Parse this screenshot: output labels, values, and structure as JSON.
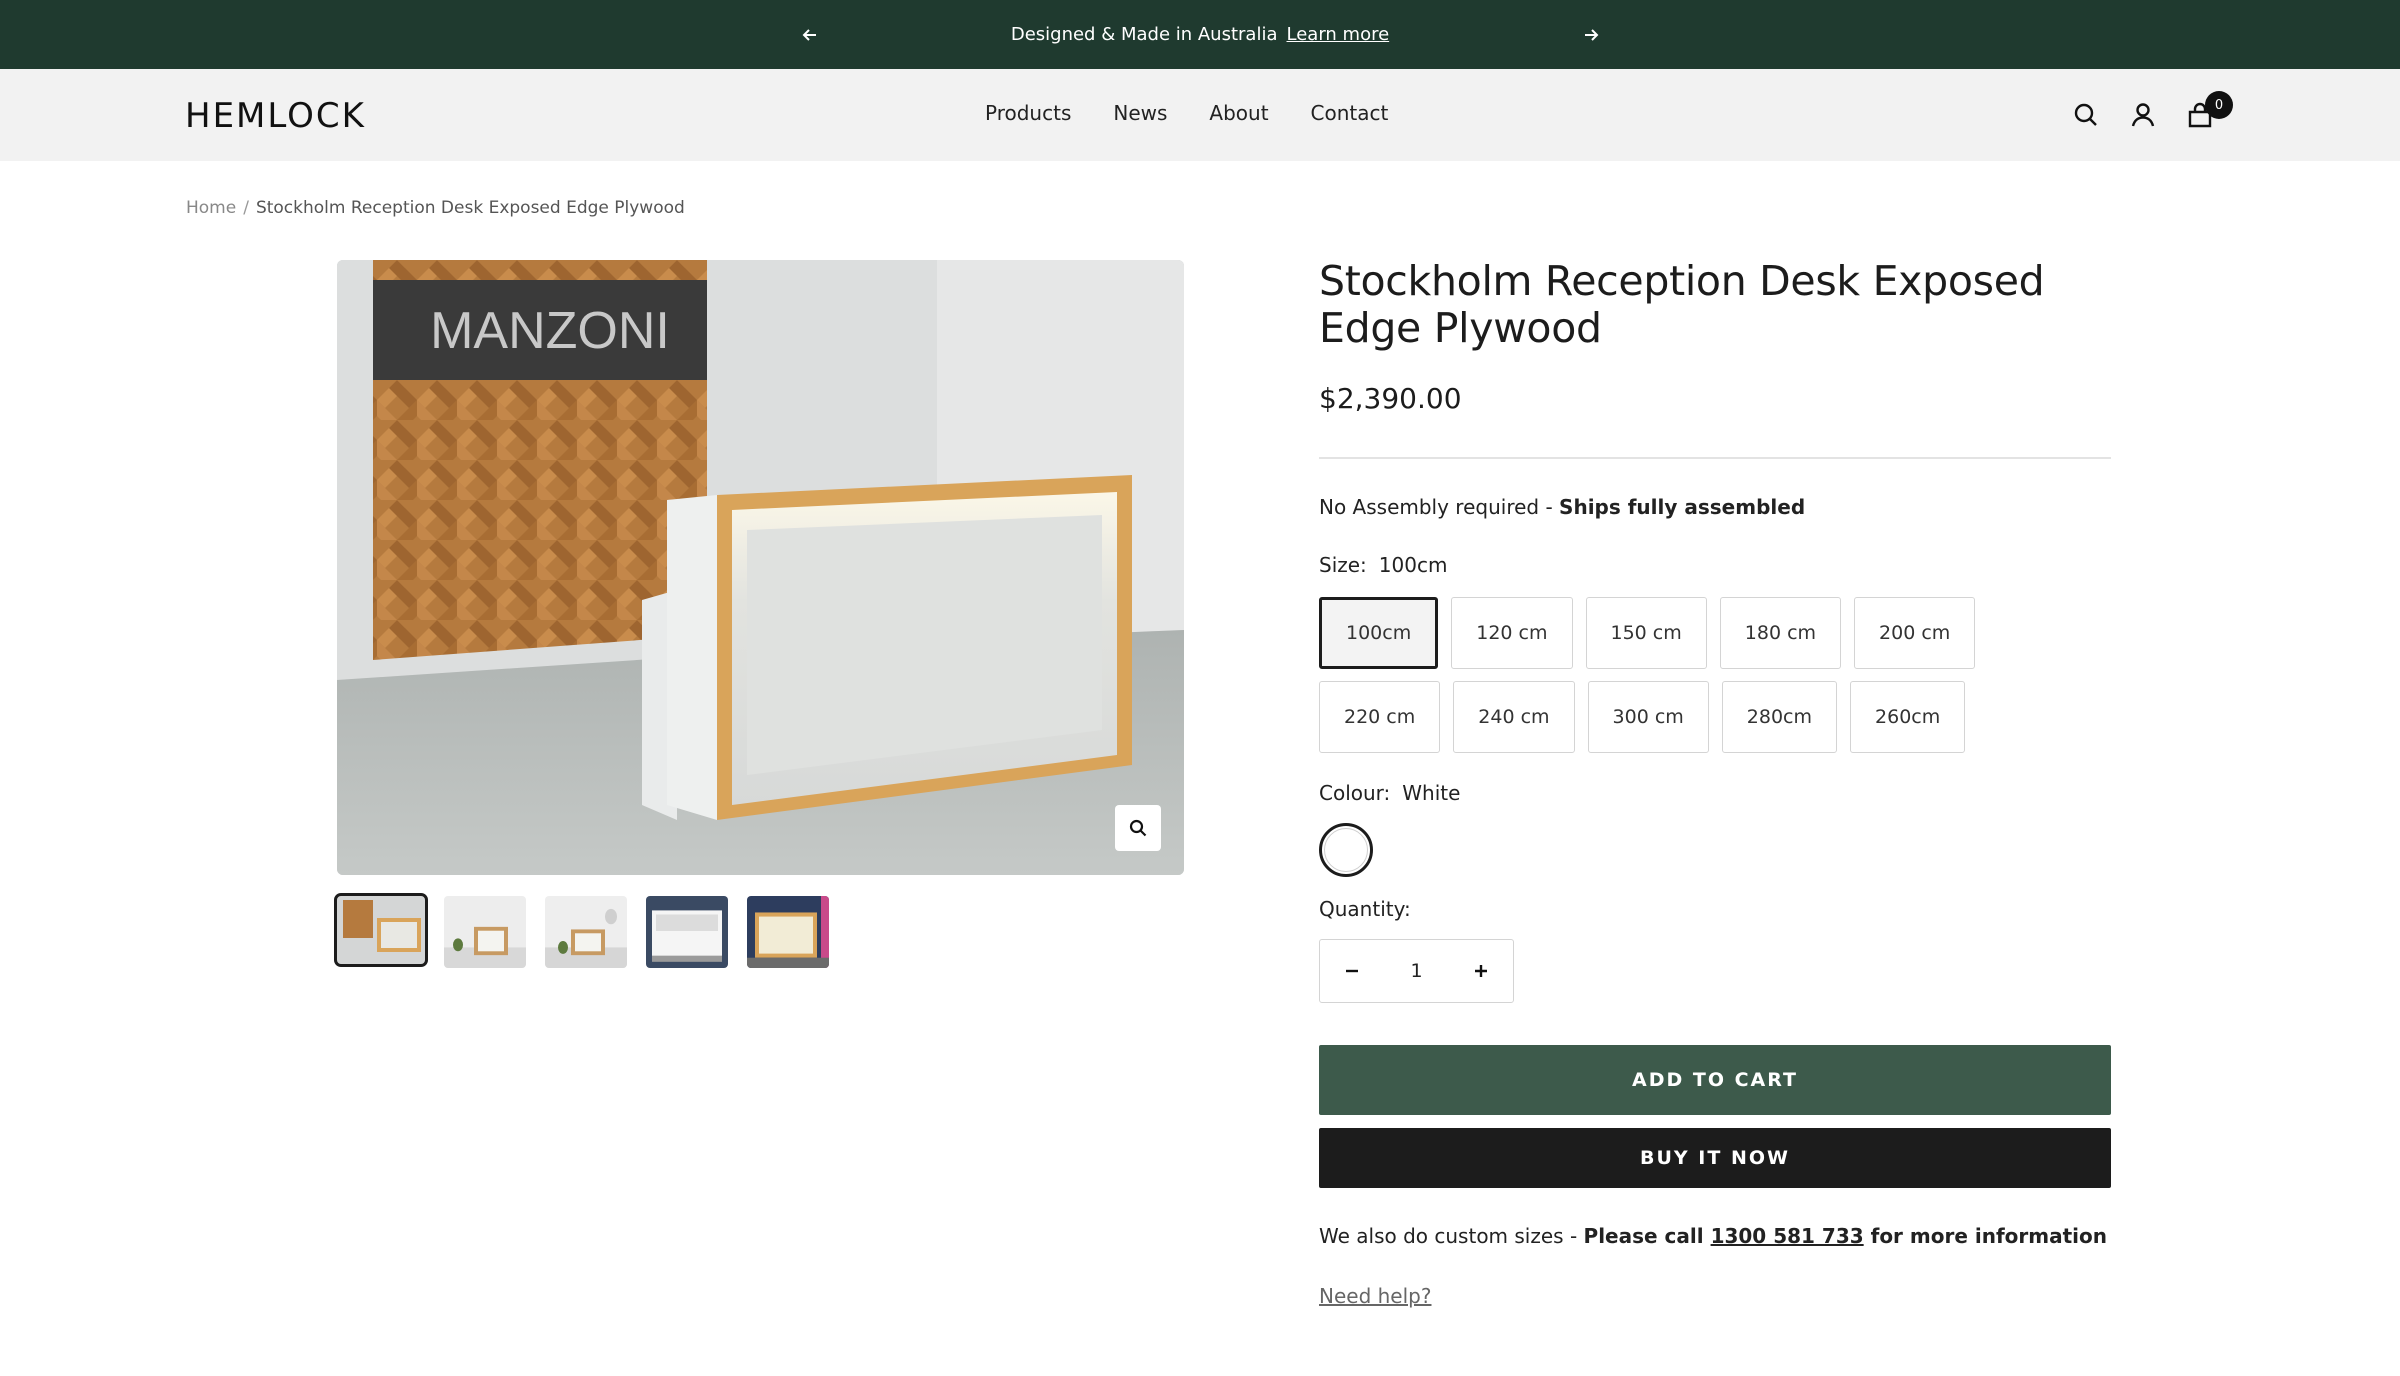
{
  "announcement": {
    "message": "Designed & Made in Australia",
    "link": "Learn more",
    "prev_icon": "arrow-left-icon",
    "next_icon": "arrow-right-icon"
  },
  "header": {
    "logo": "HEMLOCK",
    "nav": [
      "Products",
      "News",
      "About",
      "Contact"
    ],
    "cart_count": "0",
    "icons": [
      "search-icon",
      "account-icon",
      "cart-icon"
    ]
  },
  "breadcrumb": {
    "home": "Home",
    "separator": "/",
    "current": "Stockholm Reception Desk Exposed Edge Plywood"
  },
  "gallery": {
    "main_image_sign_text": "MANZONI",
    "thumbnail_count": 5,
    "zoom_icon": "zoom-icon"
  },
  "product": {
    "title": "Stockholm Reception Desk Exposed Edge Plywood",
    "price": "$2,390.00",
    "assembly_prefix": "No Assembly required - ",
    "assembly_bold": "Ships fully assembled",
    "size_label": "Size:",
    "size_selected": "100cm",
    "sizes": [
      "100cm",
      "120 cm",
      "150 cm",
      "180 cm",
      "200 cm",
      "220 cm",
      "240 cm",
      "300 cm",
      "280cm",
      "260cm"
    ],
    "colour_label": "Colour:",
    "colour_selected": "White",
    "colour_swatch": "#ffffff",
    "quantity_label": "Quantity:",
    "quantity": "1",
    "add_to_cart": "ADD TO CART",
    "buy_now": "BUY IT NOW",
    "custom_prefix": "We also do custom sizes - ",
    "custom_bold": "Please call ",
    "custom_phone": "1300 581 733",
    "custom_suffix": " for more information",
    "help_link": "Need help?"
  },
  "colors": {
    "announcement_bg": "#1f3a2f",
    "add_to_cart_bg": "#3d5a4b",
    "buy_now_bg": "#1c1c1c",
    "header_bg": "#f2f2f2"
  }
}
